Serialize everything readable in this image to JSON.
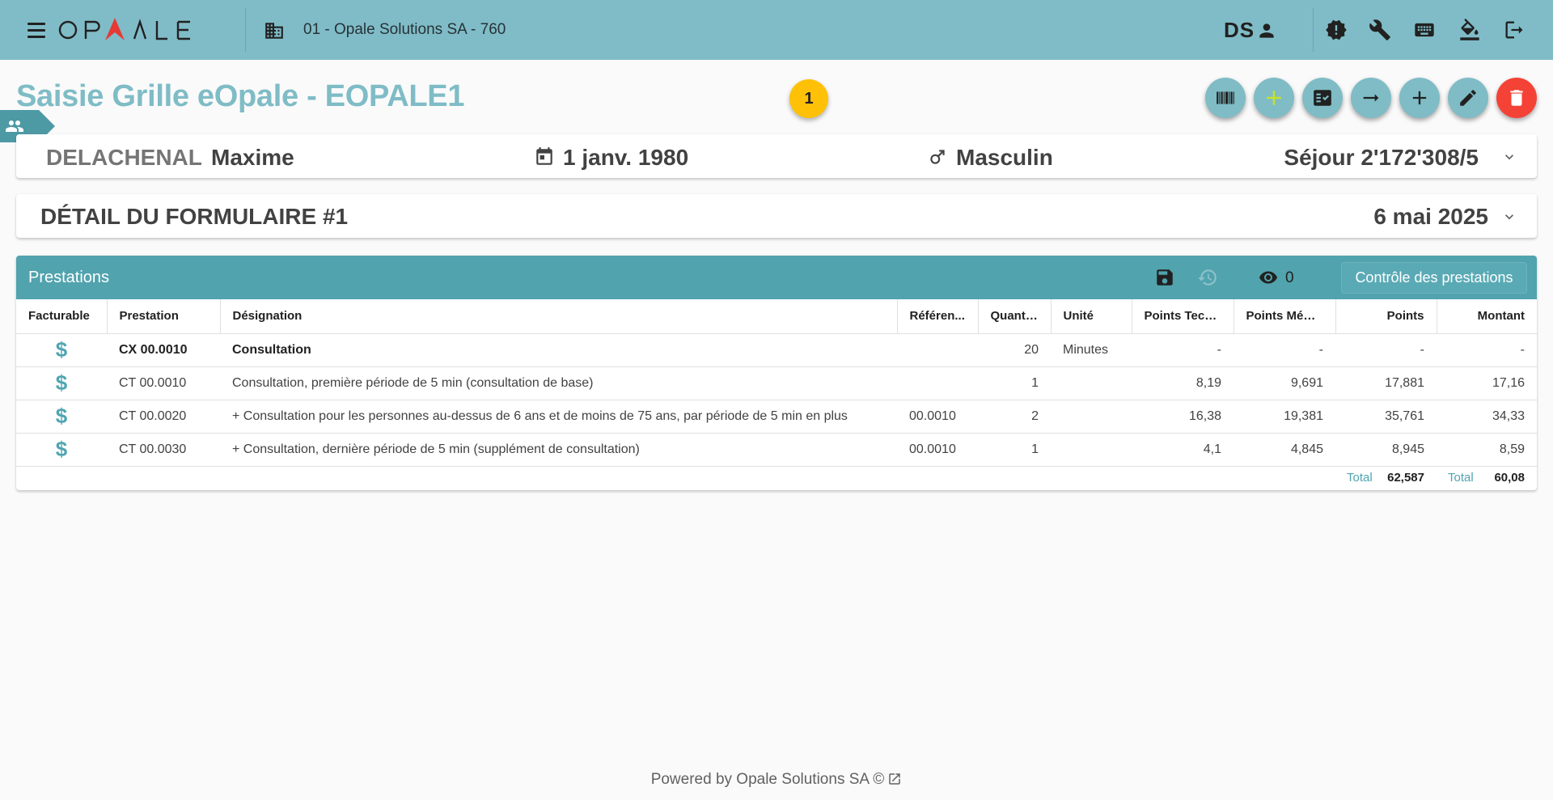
{
  "header": {
    "logo_text": "OPALE",
    "organisation": "01 -  Opale Solutions SA - 760",
    "user_initials": "DS"
  },
  "page": {
    "title": "Saisie Grille eOpale - EOPALE1",
    "badge_count": "1"
  },
  "patient": {
    "lastname": "DELACHENAL",
    "firstname": "Maxime",
    "birthdate": "1 janv. 1980",
    "sex": "Masculin",
    "sejour": "Séjour 2'172'308/5"
  },
  "form": {
    "title": "DÉTAIL DU FORMULAIRE #1",
    "date": "6 mai 2025"
  },
  "prestations": {
    "title": "Prestations",
    "view_count": "0",
    "control_button": "Contrôle des prestations",
    "columns": [
      "Facturable",
      "Prestation",
      "Désignation",
      "Référen...",
      "Quantité",
      "Unité",
      "Points Tech...",
      "Points Médi...",
      "Points",
      "Montant"
    ],
    "rows": [
      {
        "code": "CX 00.0010",
        "designation": "Consultation",
        "reference": "",
        "quantite": "20",
        "unite": "Minutes",
        "pts_tech": "-",
        "pts_med": "-",
        "points": "-",
        "montant": "-"
      },
      {
        "code": "CT 00.0010",
        "designation": "Consultation, première période de 5 min (consultation de base)",
        "reference": "",
        "quantite": "1",
        "unite": "",
        "pts_tech": "8,19",
        "pts_med": "9,691",
        "points": "17,881",
        "montant": "17,16"
      },
      {
        "code": "CT 00.0020",
        "designation": "+ Consultation pour les personnes au-dessus de 6 ans et de moins de 75 ans, par période de 5 min en plus",
        "reference": "00.0010",
        "quantite": "2",
        "unite": "",
        "pts_tech": "16,38",
        "pts_med": "19,381",
        "points": "35,761",
        "montant": "34,33"
      },
      {
        "code": "CT 00.0030",
        "designation": "+ Consultation, dernière période de 5 min (supplément de consultation)",
        "reference": "00.0010",
        "quantite": "1",
        "unite": "",
        "pts_tech": "4,1",
        "pts_med": "4,845",
        "points": "8,945",
        "montant": "8,59"
      }
    ],
    "total_label": "Total",
    "total_points": "62,587",
    "total_montant": "60,08"
  },
  "footer": {
    "text": "Powered by Opale Solutions SA ©"
  },
  "colors": {
    "topbar": "#80bcc7",
    "accent": "#7fbcc6",
    "panel_header": "#51a3ae",
    "badge": "#ffc107",
    "delete": "#f44336"
  }
}
